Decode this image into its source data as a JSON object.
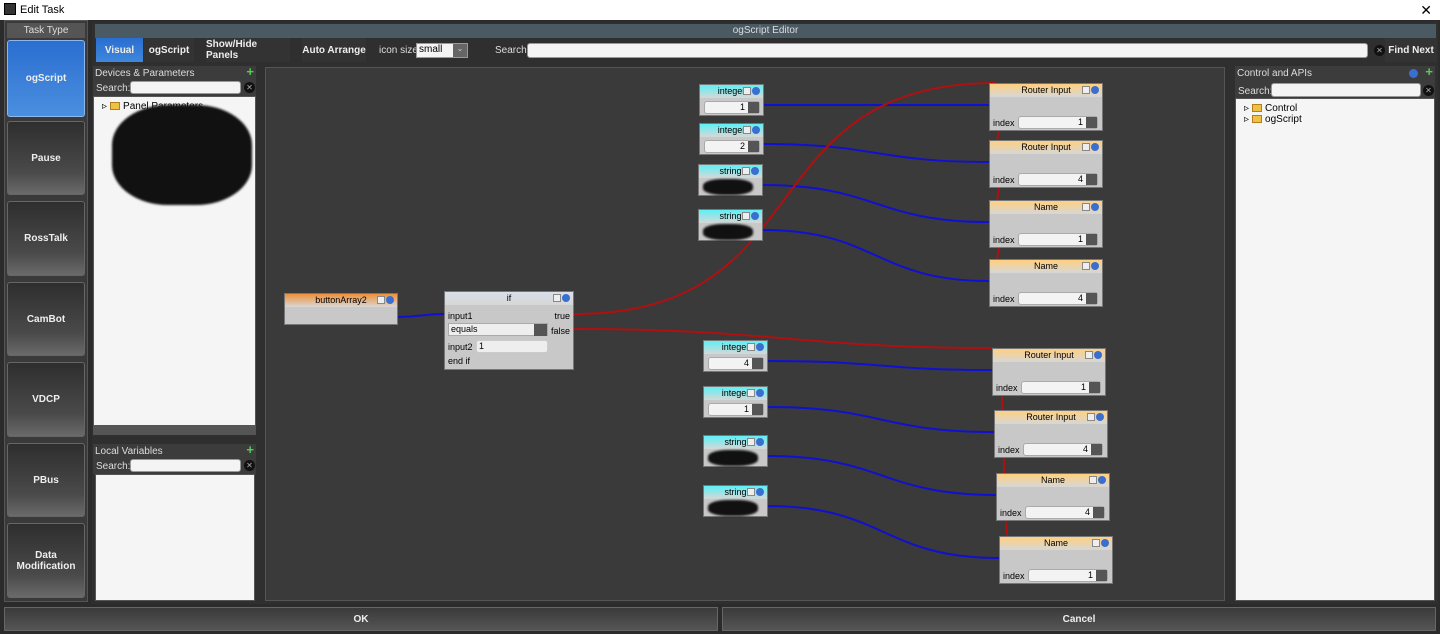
{
  "window": {
    "title": "Edit Task"
  },
  "task_type": {
    "header": "Task Type",
    "items": [
      "ogScript",
      "Pause",
      "RossTalk",
      "CamBot",
      "VDCP",
      "PBus",
      "Data Modification"
    ],
    "selected": "ogScript"
  },
  "editor": {
    "title": "ogScript Editor",
    "tabs": [
      "Visual",
      "ogScript"
    ],
    "show_hide": "Show/Hide Panels",
    "auto_arrange": "Auto Arrange",
    "icon_size_label": "icon size:",
    "icon_size_value": "small",
    "search_label": "Search:",
    "search_value": "",
    "find_next": "Find Next"
  },
  "devices": {
    "title": "Devices & Parameters",
    "search_label": "Search:",
    "first_item": "Panel Parameters"
  },
  "locals": {
    "title": "Local Variables",
    "search_label": "Search:"
  },
  "apis": {
    "title": "Control and APIs",
    "search_label": "Search:",
    "items": [
      "Control",
      "ogScript"
    ]
  },
  "nodes": {
    "button": {
      "title": "buttonArray2"
    },
    "if": {
      "title": "if",
      "input1": "input1",
      "op": "equals",
      "input2": "input2",
      "input2_value": "1",
      "end": "end if",
      "true": "true",
      "false": "false"
    },
    "values": [
      {
        "title": "integer",
        "value": "1"
      },
      {
        "title": "integer",
        "value": "2"
      },
      {
        "title": "string",
        "value": ""
      },
      {
        "title": "string",
        "value": ""
      },
      {
        "title": "integer",
        "value": "4"
      },
      {
        "title": "integer",
        "value": "1"
      },
      {
        "title": "string",
        "value": ""
      },
      {
        "title": "string",
        "value": ""
      }
    ],
    "targets": [
      {
        "title": "Router Input",
        "index_label": "index",
        "index": "1"
      },
      {
        "title": "Router Input",
        "index_label": "index",
        "index": "4"
      },
      {
        "title": "Name",
        "index_label": "index",
        "index": "1"
      },
      {
        "title": "Name",
        "index_label": "index",
        "index": "4"
      },
      {
        "title": "Router Input",
        "index_label": "index",
        "index": "1"
      },
      {
        "title": "Router Input",
        "index_label": "index",
        "index": "4"
      },
      {
        "title": "Name",
        "index_label": "index",
        "index": "4"
      },
      {
        "title": "Name",
        "index_label": "index",
        "index": "1"
      }
    ]
  },
  "footer": {
    "ok": "OK",
    "cancel": "Cancel"
  },
  "colors": {
    "accent": "#2a6ed0",
    "value_header": "#5ef0f5",
    "target_header": "#ffd080",
    "button_header": "#f0903a",
    "wire_data": "#1010d0",
    "wire_flow": "#b01010"
  }
}
